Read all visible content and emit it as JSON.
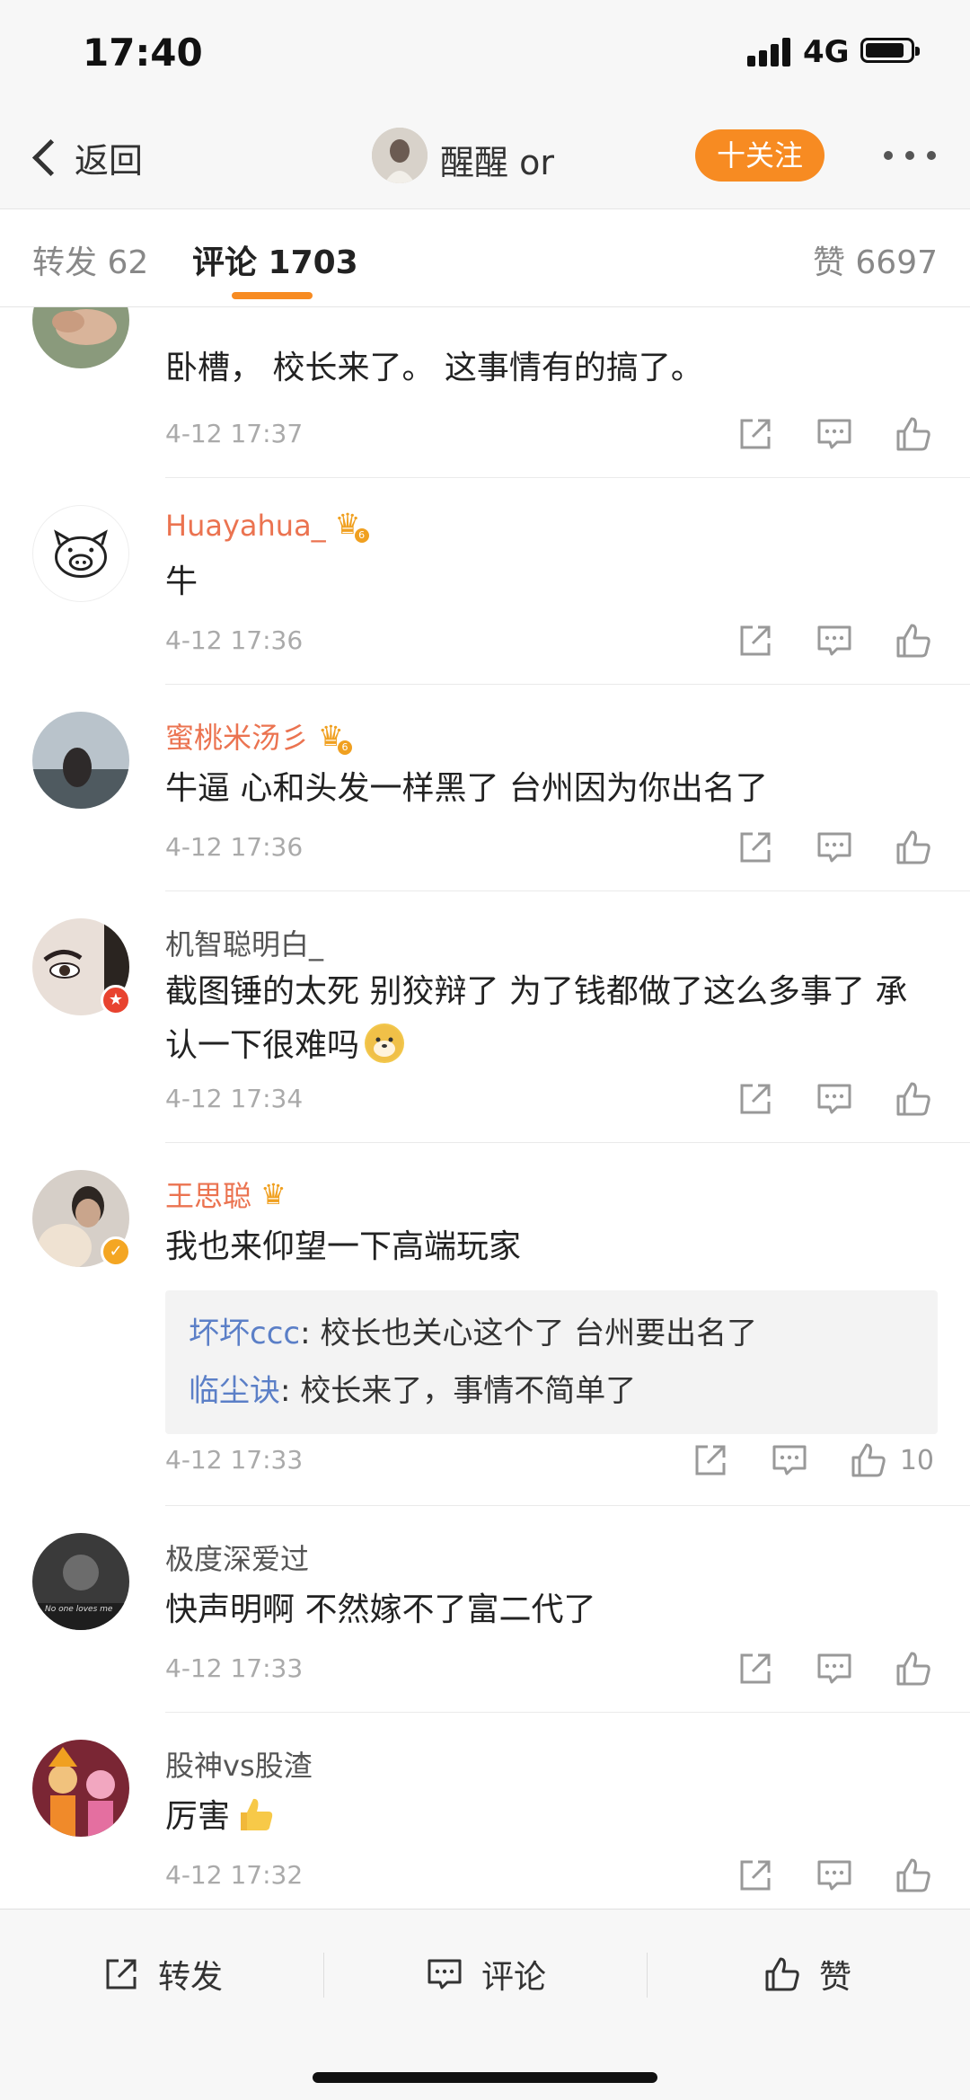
{
  "status_bar": {
    "time": "17:40",
    "network": "4G"
  },
  "nav": {
    "back_label": "返回",
    "user_name": "醒醒 or",
    "follow_label": "十关注"
  },
  "tabs": [
    {
      "label": "转发 62"
    },
    {
      "label": "评论 1703"
    },
    {
      "label": "赞 6697"
    }
  ],
  "colors": {
    "accent": "#f78b22",
    "vip_name": "#eb7350",
    "reply_name": "#5b7fc7",
    "time": "#aaaaaa"
  },
  "comments": [
    {
      "user": "",
      "text": "卧槽， 校长来了。 这事情有的搞了。",
      "time": "4-12 17:37"
    },
    {
      "user": "Huayahua_",
      "vip_level": "6",
      "text": "牛",
      "time": "4-12 17:36"
    },
    {
      "user": "蜜桃米汤彡",
      "vip_level": "6",
      "text": "牛逼 心和头发一样黑了 台州因为你出名了",
      "time": "4-12 17:36"
    },
    {
      "user": "机智聪明白_",
      "text": "截图锤的太死 别狡辩了  为了钱都做了这么多事了  承认一下很难吗",
      "time": "4-12 17:34"
    },
    {
      "user": "王思聪",
      "text": "我也来仰望一下高端玩家",
      "time": "4-12 17:33",
      "like_count": "10",
      "replies": [
        {
          "name": "坏坏ccc",
          "text": ": 校长也关心这个了 台州要出名了"
        },
        {
          "name": "临尘诀",
          "text": ": 校长来了，事情不简单了"
        }
      ]
    },
    {
      "user": "极度深爱过",
      "text": "快声明啊 不然嫁不了富二代了",
      "time": "4-12 17:33",
      "avatar_caption": "No one loves me"
    },
    {
      "user": "股神vs股渣",
      "text": "厉害",
      "time": "4-12 17:32"
    }
  ],
  "bottom_bar": {
    "repost": "转发",
    "comment": "评论",
    "like": "赞"
  },
  "icons": [
    "back-chevron-icon",
    "more-icon",
    "share-icon",
    "comment-icon",
    "like-icon",
    "crown-icon",
    "emoji-doge-icon",
    "emoji-thumbs-up-icon"
  ]
}
